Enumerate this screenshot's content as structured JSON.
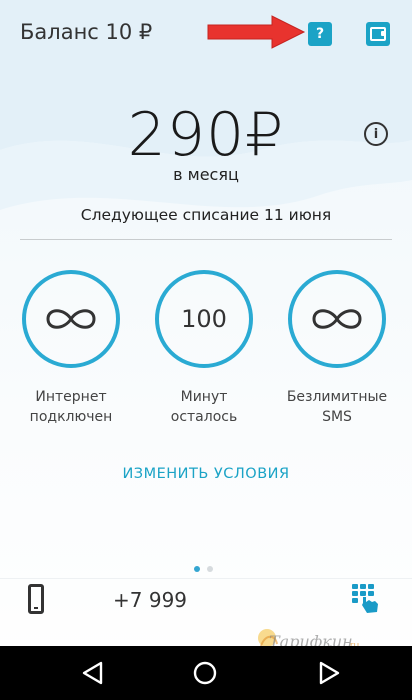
{
  "header": {
    "balance": "Баланс 10 ₽",
    "help_icon": "question-icon",
    "wallet_icon": "wallet-icon"
  },
  "tariff": {
    "price": "290₽",
    "period": "в месяц",
    "next_charge": "Следующее списание 11 июня"
  },
  "services": [
    {
      "value": "∞",
      "icon": "infinity-icon",
      "label_line1": "Интернет",
      "label_line2": "подключен"
    },
    {
      "value": "100",
      "label_line1": "Минут",
      "label_line2": "осталось"
    },
    {
      "value": "∞",
      "icon": "infinity-icon",
      "label_line1": "Безлимитные",
      "label_line2": "SMS"
    }
  ],
  "actions": {
    "change_conditions": "ИЗМЕНИТЬ УСЛОВИЯ"
  },
  "pager": {
    "page": 1,
    "total": 2
  },
  "footer": {
    "phone_number": "+7 999"
  },
  "watermark": {
    "text": "Тарифкин.ru"
  },
  "colors": {
    "accent": "#2aaad3",
    "link": "#1ba3c6",
    "arrow": "#e8332e",
    "nav_bar": "#000000"
  }
}
